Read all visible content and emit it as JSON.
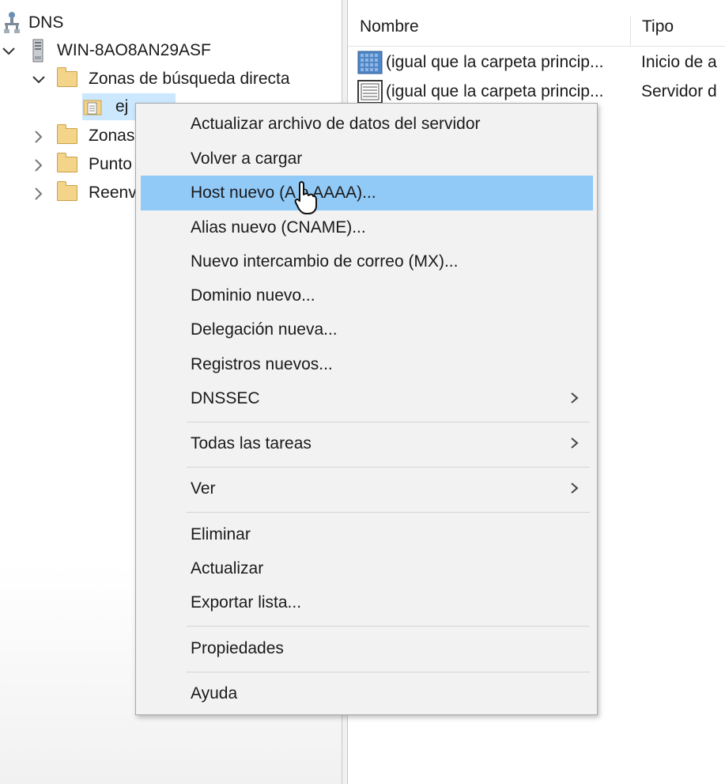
{
  "tree": {
    "root": "DNS",
    "server": "WIN-8AO8AN29ASF",
    "forward_zones": "Zonas de búsqueda directa",
    "selected_zone": "ej",
    "reverse_zones": "Zonas",
    "trust_points": "Punto",
    "forwarders": "Reenv"
  },
  "list": {
    "columns": [
      "Nombre",
      "Tipo"
    ],
    "rows": [
      {
        "name": "(igual que la carpeta princip...",
        "type": "Inicio de a",
        "icon": "soa-record-icon"
      },
      {
        "name": "(igual que la carpeta princip...",
        "type": "Servidor d",
        "icon": "ns-record-icon"
      }
    ]
  },
  "context_menu": {
    "items": [
      {
        "label": "Actualizar archivo de datos del servidor"
      },
      {
        "label": "Volver a cargar"
      },
      {
        "label": "Host nuevo (A o AAAA)...",
        "highlighted": true
      },
      {
        "label": "Alias nuevo (CNAME)..."
      },
      {
        "label": "Nuevo intercambio de correo (MX)..."
      },
      {
        "label": "Dominio nuevo..."
      },
      {
        "label": "Delegación nueva..."
      },
      {
        "label": "Registros nuevos..."
      },
      {
        "label": "DNSSEC",
        "submenu": true
      },
      {
        "label": "Todas las tareas",
        "submenu": true
      },
      {
        "label": "Ver",
        "submenu": true
      },
      {
        "label": "Eliminar"
      },
      {
        "label": "Actualizar"
      },
      {
        "label": "Exportar lista..."
      },
      {
        "label": "Propiedades"
      },
      {
        "label": "Ayuda"
      }
    ]
  },
  "colors": {
    "highlight": "#91c9f7",
    "menu_background": "#f2f2f2",
    "folder": "#f3d489"
  }
}
